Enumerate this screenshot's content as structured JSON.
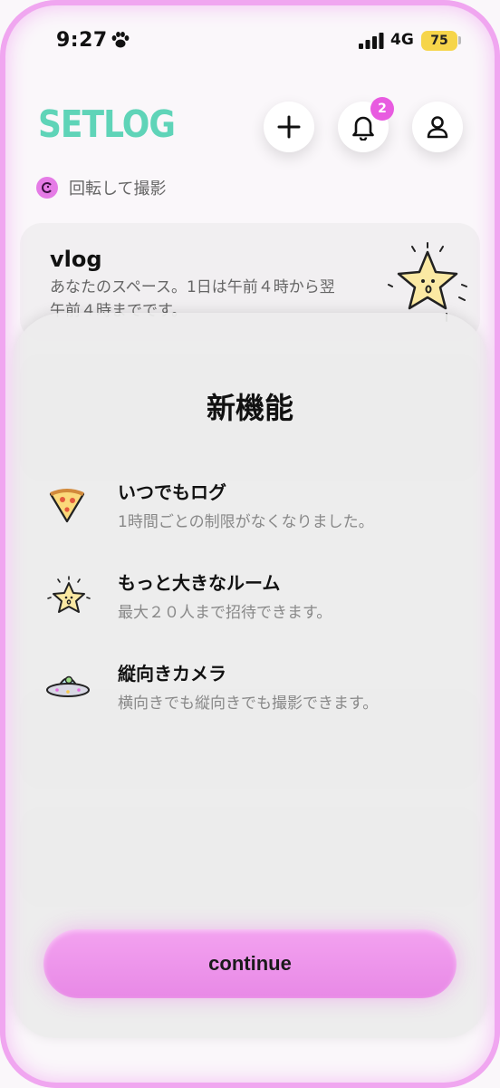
{
  "status_bar": {
    "time": "9:27",
    "network": "4G",
    "battery": "75",
    "icons": [
      "paw-icon",
      "signal-icon"
    ]
  },
  "header": {
    "logo": "SETLOG",
    "logo_color": "#5fd4b8",
    "notification_count": "2",
    "buttons": [
      "plus-icon",
      "bell-icon",
      "person-icon"
    ]
  },
  "rotate_hint": {
    "text": "回転して撮影",
    "icon": "rotate-icon"
  },
  "space_card": {
    "title": "vlog",
    "description": "あなたのスペース。1日は午前４時から翌午前４時までです。",
    "icon": "star-character-icon"
  },
  "sheet": {
    "title": "新機能",
    "features": [
      {
        "icon": "pizza-icon",
        "title": "いつでもログ",
        "description": "1時間ごとの制限がなくなりました。"
      },
      {
        "icon": "star-character-icon",
        "title": "もっと大きなルーム",
        "description": "最大２０人まで招待できます。"
      },
      {
        "icon": "ufo-icon",
        "title": "縦向きカメラ",
        "description": "横向きでも縦向きでも撮影できます。"
      }
    ],
    "continue_label": "continue",
    "accent": "#ee8fee"
  }
}
